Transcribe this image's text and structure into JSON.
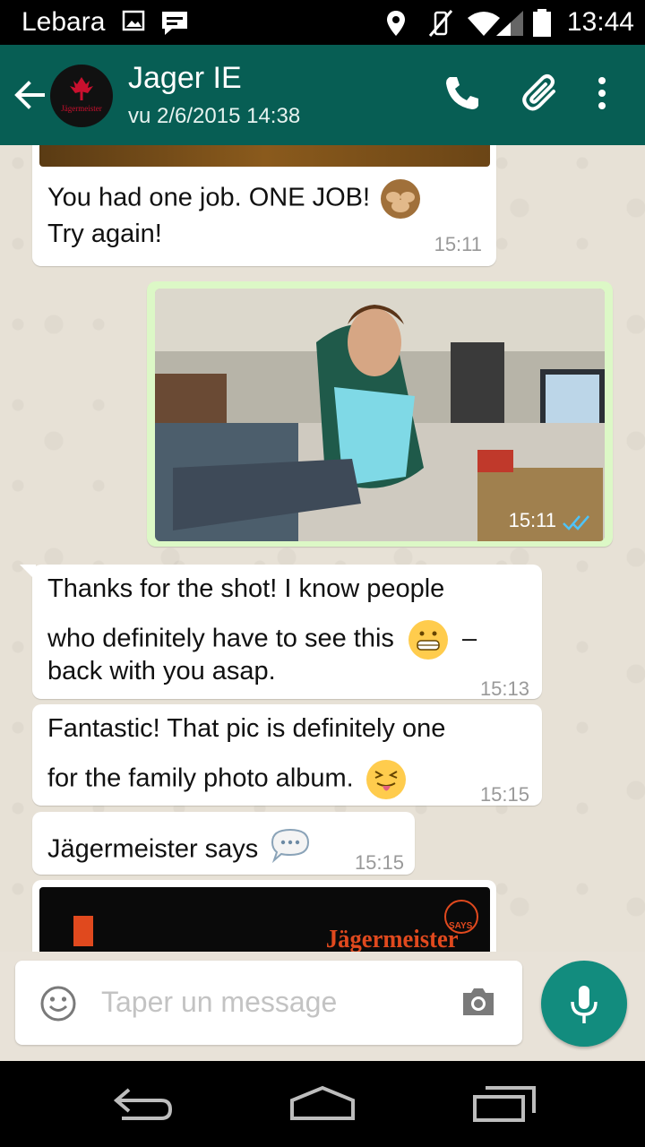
{
  "status_bar": {
    "carrier": "Lebara",
    "time": "13:44"
  },
  "header": {
    "contact_name": "Jager IE",
    "last_seen": "vu 2/6/2015 14:38",
    "avatar_text": "Jägermeister"
  },
  "messages": [
    {
      "direction": "in",
      "text_line1": "You had one job. ONE JOB!",
      "text_line2": "Try again!",
      "time": "15:11"
    },
    {
      "direction": "out",
      "type": "photo",
      "time": "15:11",
      "status": "read"
    },
    {
      "direction": "in",
      "text_line1": "Thanks for the shot! I know people",
      "text_line2": "who definitely have to see this",
      "text_line2b": "–",
      "text_line3": "back with you asap.",
      "time": "15:13"
    },
    {
      "direction": "in",
      "text_line1": "Fantastic! That pic is definitely one",
      "text_line2": "for the family photo album.",
      "time": "15:15"
    },
    {
      "direction": "in",
      "text_line1": "Jägermeister says",
      "time": "15:15"
    },
    {
      "direction": "in",
      "type": "image",
      "brand_text": "Jägermeister",
      "badge_text": "SAYS"
    }
  ],
  "composer": {
    "placeholder": "Taper un message"
  },
  "colors": {
    "header": "#075e54",
    "outgoing_bubble": "#dcf8c6",
    "mic_button": "#128c7e",
    "read_ticks": "#4fc3f7"
  }
}
